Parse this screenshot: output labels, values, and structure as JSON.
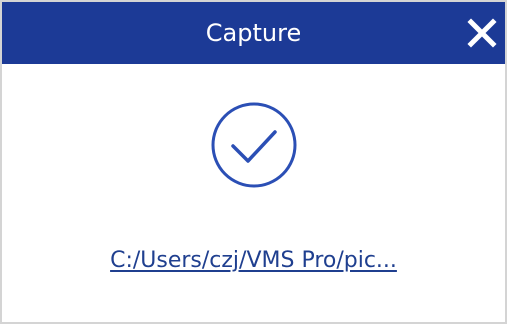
{
  "dialog": {
    "title": "Capture",
    "close_icon": "close-icon",
    "success_icon": "check-circle-icon",
    "file_path": "C:/Users/czj/VMS Pro/pic..."
  },
  "colors": {
    "title_bar": "#1c3a96",
    "title_text": "#ffffff",
    "accent": "#2b4fb5",
    "link": "#1f3f8f",
    "background": "#ffffff"
  }
}
